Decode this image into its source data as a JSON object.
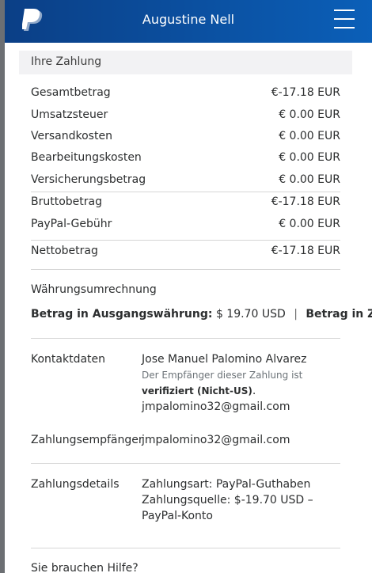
{
  "header": {
    "title": "Augustine Nell",
    "logo_icon": "paypal-logo",
    "menu_icon": "hamburger-menu-icon",
    "bg_color": "#0b4ea2"
  },
  "payment": {
    "section_title": "Ihre Zahlung",
    "rows": [
      {
        "label": "Gesamtbetrag",
        "value": "€-17.18 EUR"
      },
      {
        "label": "Umsatzsteuer",
        "value": "€ 0.00 EUR"
      },
      {
        "label": "Versandkosten",
        "value": "€ 0.00 EUR"
      },
      {
        "label": "Bearbeitungskosten",
        "value": "€ 0.00 EUR"
      },
      {
        "label": "Versicherungsbetrag",
        "value": "€ 0.00 EUR"
      },
      {
        "label": "Bruttobetrag",
        "value": "€-17.18 EUR"
      },
      {
        "label": "PayPal-Gebühr",
        "value": "€ 0.00 EUR"
      },
      {
        "label": "Nettobetrag",
        "value": "€-17.18 EUR"
      }
    ]
  },
  "conversion": {
    "title": "Währungsumrechnung",
    "source_label": "Betrag in Ausgangswährung:",
    "source_value": "$ 19.70 USD",
    "separator": "|",
    "target_label": "Betrag in Zielwähru"
  },
  "contact": {
    "label": "Kontaktdaten",
    "name": "Jose Manuel Palomino Alvarez",
    "note": "Der Empfänger dieser Zahlung ist",
    "status": "verifiziert (Nicht-US)",
    "status_suffix": ".",
    "email": "jmpalomino32@gmail.com"
  },
  "recipient": {
    "label": "Zahlungsempfänger",
    "email": "jmpalomino32@gmail.com"
  },
  "details": {
    "label": "Zahlungsdetails",
    "line1": "Zahlungsart: PayPal-Guthaben",
    "line2": "Zahlungsquelle: $-19.70 USD –",
    "line3": "PayPal-Konto"
  },
  "help": {
    "title": "Sie brauchen Hilfe?"
  }
}
